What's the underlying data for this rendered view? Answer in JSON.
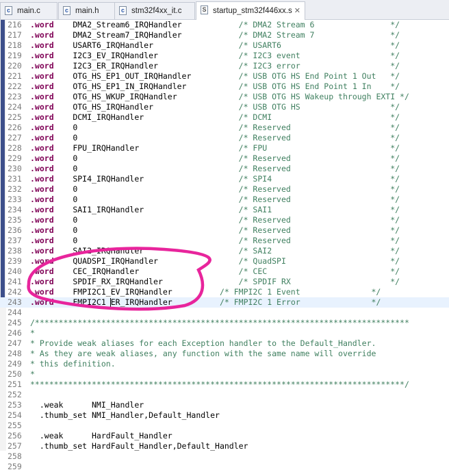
{
  "tabs": [
    {
      "label": "main.c",
      "icon": "c-file-icon",
      "icon_glyph": "c"
    },
    {
      "label": "main.h",
      "icon": "h-file-icon",
      "icon_glyph": "c"
    },
    {
      "label": "stm32f4xx_it.c",
      "icon": "c-file-icon",
      "icon_glyph": "c"
    },
    {
      "label": "startup_stm32f446xx.s",
      "icon": "asm-file-icon",
      "icon_glyph": "S",
      "active": true,
      "close": "✕"
    }
  ],
  "lines": [
    {
      "n": "216",
      "kw": ".word",
      "rest": "    DMA2_Stream6_IRQHandler            ",
      "cm": "/* DMA2 Stream 6                */"
    },
    {
      "n": "217",
      "kw": ".word",
      "rest": "    DMA2_Stream7_IRQHandler            ",
      "cm": "/* DMA2 Stream 7                */"
    },
    {
      "n": "218",
      "kw": ".word",
      "rest": "    USART6_IRQHandler                  ",
      "cm": "/* USART6                       */"
    },
    {
      "n": "219",
      "kw": ".word",
      "rest": "    I2C3_EV_IRQHandler                 ",
      "cm": "/* I2C3 event                   */"
    },
    {
      "n": "220",
      "kw": ".word",
      "rest": "    I2C3_ER_IRQHandler                 ",
      "cm": "/* I2C3 error                   */"
    },
    {
      "n": "221",
      "kw": ".word",
      "rest": "    OTG_HS_EP1_OUT_IRQHandler          ",
      "cm": "/* USB OTG HS End Point 1 Out   */"
    },
    {
      "n": "222",
      "kw": ".word",
      "rest": "    OTG_HS_EP1_IN_IRQHandler           ",
      "cm": "/* USB OTG HS End Point 1 In    */"
    },
    {
      "n": "223",
      "kw": ".word",
      "rest": "    OTG_HS_WKUP_IRQHandler             ",
      "cm": "/* USB OTG HS Wakeup through EXTI */"
    },
    {
      "n": "224",
      "kw": ".word",
      "rest": "    OTG_HS_IRQHandler                  ",
      "cm": "/* USB OTG HS                   */"
    },
    {
      "n": "225",
      "kw": ".word",
      "rest": "    DCMI_IRQHandler                    ",
      "cm": "/* DCMI                         */"
    },
    {
      "n": "226",
      "kw": ".word",
      "rest": "    0                                  ",
      "cm": "/* Reserved                     */"
    },
    {
      "n": "227",
      "kw": ".word",
      "rest": "    0                                  ",
      "cm": "/* Reserved                     */"
    },
    {
      "n": "228",
      "kw": ".word",
      "rest": "    FPU_IRQHandler                     ",
      "cm": "/* FPU                          */"
    },
    {
      "n": "229",
      "kw": ".word",
      "rest": "    0                                  ",
      "cm": "/* Reserved                     */"
    },
    {
      "n": "230",
      "kw": ".word",
      "rest": "    0                                  ",
      "cm": "/* Reserved                     */"
    },
    {
      "n": "231",
      "kw": ".word",
      "rest": "    SPI4_IRQHandler                    ",
      "cm": "/* SPI4                         */"
    },
    {
      "n": "232",
      "kw": ".word",
      "rest": "    0                                  ",
      "cm": "/* Reserved                     */"
    },
    {
      "n": "233",
      "kw": ".word",
      "rest": "    0                                  ",
      "cm": "/* Reserved                     */"
    },
    {
      "n": "234",
      "kw": ".word",
      "rest": "    SAI1_IRQHandler                    ",
      "cm": "/* SAI1                         */"
    },
    {
      "n": "235",
      "kw": ".word",
      "rest": "    0                                  ",
      "cm": "/* Reserved                     */"
    },
    {
      "n": "236",
      "kw": ".word",
      "rest": "    0                                  ",
      "cm": "/* Reserved                     */"
    },
    {
      "n": "237",
      "kw": ".word",
      "rest": "    0                                  ",
      "cm": "/* Reserved                     */"
    },
    {
      "n": "238",
      "kw": ".word",
      "rest": "    SAI2_IRQHandler                    ",
      "cm": "/* SAI2                         */"
    },
    {
      "n": "239",
      "kw": ".word",
      "rest": "    QUADSPI_IRQHandler                 ",
      "cm": "/* QuadSPI                      */"
    },
    {
      "n": "240",
      "kw": ".word",
      "rest": "    CEC_IRQHandler                     ",
      "cm": "/* CEC                          */"
    },
    {
      "n": "241",
      "kw": ".word",
      "rest": "    SPDIF_RX_IRQHandler                ",
      "cm": "/* SPDIF RX                     */"
    },
    {
      "n": "242",
      "kw": ".word",
      "rest": "    FMPI2C1_EV_IRQHandler          ",
      "cm": "/* FMPI2C 1 Event               */"
    },
    {
      "n": "243",
      "kw": ".word",
      "rest": "    FMPI2C1_ER_IRQHandler          ",
      "cm": "/* FMPI2C 1 Error               */",
      "current": true
    },
    {
      "n": "244",
      "kw": "",
      "rest": "",
      "cm": ""
    },
    {
      "n": "245",
      "kw": "",
      "rest": "",
      "cm": "/*******************************************************************************"
    },
    {
      "n": "246",
      "kw": "",
      "rest": "",
      "cm": "*"
    },
    {
      "n": "247",
      "kw": "",
      "rest": "",
      "cm": "* Provide weak aliases for each Exception handler to the Default_Handler."
    },
    {
      "n": "248",
      "kw": "",
      "rest": "",
      "cm": "* As they are weak aliases, any function with the same name will override"
    },
    {
      "n": "249",
      "kw": "",
      "rest": "",
      "cm": "* this definition."
    },
    {
      "n": "250",
      "kw": "",
      "rest": "",
      "cm": "*"
    },
    {
      "n": "251",
      "kw": "",
      "rest": "",
      "cm": "*******************************************************************************/"
    },
    {
      "n": "252",
      "kw": "",
      "rest": "",
      "cm": ""
    },
    {
      "n": "253",
      "kw": "",
      "rest": "  .weak      NMI_Handler",
      "cm": ""
    },
    {
      "n": "254",
      "kw": "",
      "rest": "  .thumb_set NMI_Handler,Default_Handler",
      "cm": ""
    },
    {
      "n": "255",
      "kw": "",
      "rest": "",
      "cm": ""
    },
    {
      "n": "256",
      "kw": "",
      "rest": "  .weak      HardFault_Handler",
      "cm": ""
    },
    {
      "n": "257",
      "kw": "",
      "rest": "  .thumb_set HardFault_Handler,Default_Handler",
      "cm": ""
    },
    {
      "n": "258",
      "kw": "",
      "rest": "",
      "cm": ""
    },
    {
      "n": "259",
      "kw": "",
      "rest": "",
      "cm": ""
    }
  ],
  "annotation": {
    "stroke": "#e8259c"
  },
  "colors": {
    "keyword": "#7f0055",
    "comment": "#3f7f5f",
    "line_number": "#7b7b7b",
    "marker": "#3d4f8a"
  }
}
